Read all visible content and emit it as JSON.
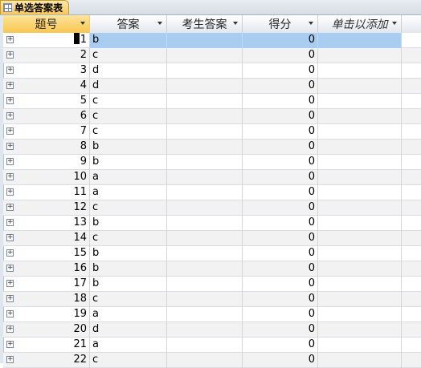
{
  "tab": {
    "label": "单选答案表"
  },
  "columns": [
    {
      "label": "题号"
    },
    {
      "label": "答案"
    },
    {
      "label": "考生答案"
    },
    {
      "label": "得分"
    },
    {
      "label": "单击以添加"
    }
  ],
  "rows": [
    {
      "no": "1",
      "answer": "b",
      "student": "",
      "score": "0"
    },
    {
      "no": "2",
      "answer": "c",
      "student": "",
      "score": "0"
    },
    {
      "no": "3",
      "answer": "d",
      "student": "",
      "score": "0"
    },
    {
      "no": "4",
      "answer": "d",
      "student": "",
      "score": "0"
    },
    {
      "no": "5",
      "answer": "c",
      "student": "",
      "score": "0"
    },
    {
      "no": "6",
      "answer": "c",
      "student": "",
      "score": "0"
    },
    {
      "no": "7",
      "answer": "c",
      "student": "",
      "score": "0"
    },
    {
      "no": "8",
      "answer": "b",
      "student": "",
      "score": "0"
    },
    {
      "no": "9",
      "answer": "b",
      "student": "",
      "score": "0"
    },
    {
      "no": "10",
      "answer": "a",
      "student": "",
      "score": "0"
    },
    {
      "no": "11",
      "answer": "a",
      "student": "",
      "score": "0"
    },
    {
      "no": "12",
      "answer": "c",
      "student": "",
      "score": "0"
    },
    {
      "no": "13",
      "answer": "b",
      "student": "",
      "score": "0"
    },
    {
      "no": "14",
      "answer": "c",
      "student": "",
      "score": "0"
    },
    {
      "no": "15",
      "answer": "b",
      "student": "",
      "score": "0"
    },
    {
      "no": "16",
      "answer": "b",
      "student": "",
      "score": "0"
    },
    {
      "no": "17",
      "answer": "b",
      "student": "",
      "score": "0"
    },
    {
      "no": "18",
      "answer": "c",
      "student": "",
      "score": "0"
    },
    {
      "no": "19",
      "answer": "a",
      "student": "",
      "score": "0"
    },
    {
      "no": "20",
      "answer": "d",
      "student": "",
      "score": "0"
    },
    {
      "no": "21",
      "answer": "a",
      "student": "",
      "score": "0"
    },
    {
      "no": "22",
      "answer": "c",
      "student": "",
      "score": "0"
    }
  ],
  "colors": {
    "selection": "#a8cdf0",
    "active_header": "#f7c651",
    "alt_row": "#f2f2f2"
  },
  "icons": {
    "expand": "plus-box-icon",
    "dropdown": "dropdown-arrow-icon",
    "table": "table-icon"
  }
}
